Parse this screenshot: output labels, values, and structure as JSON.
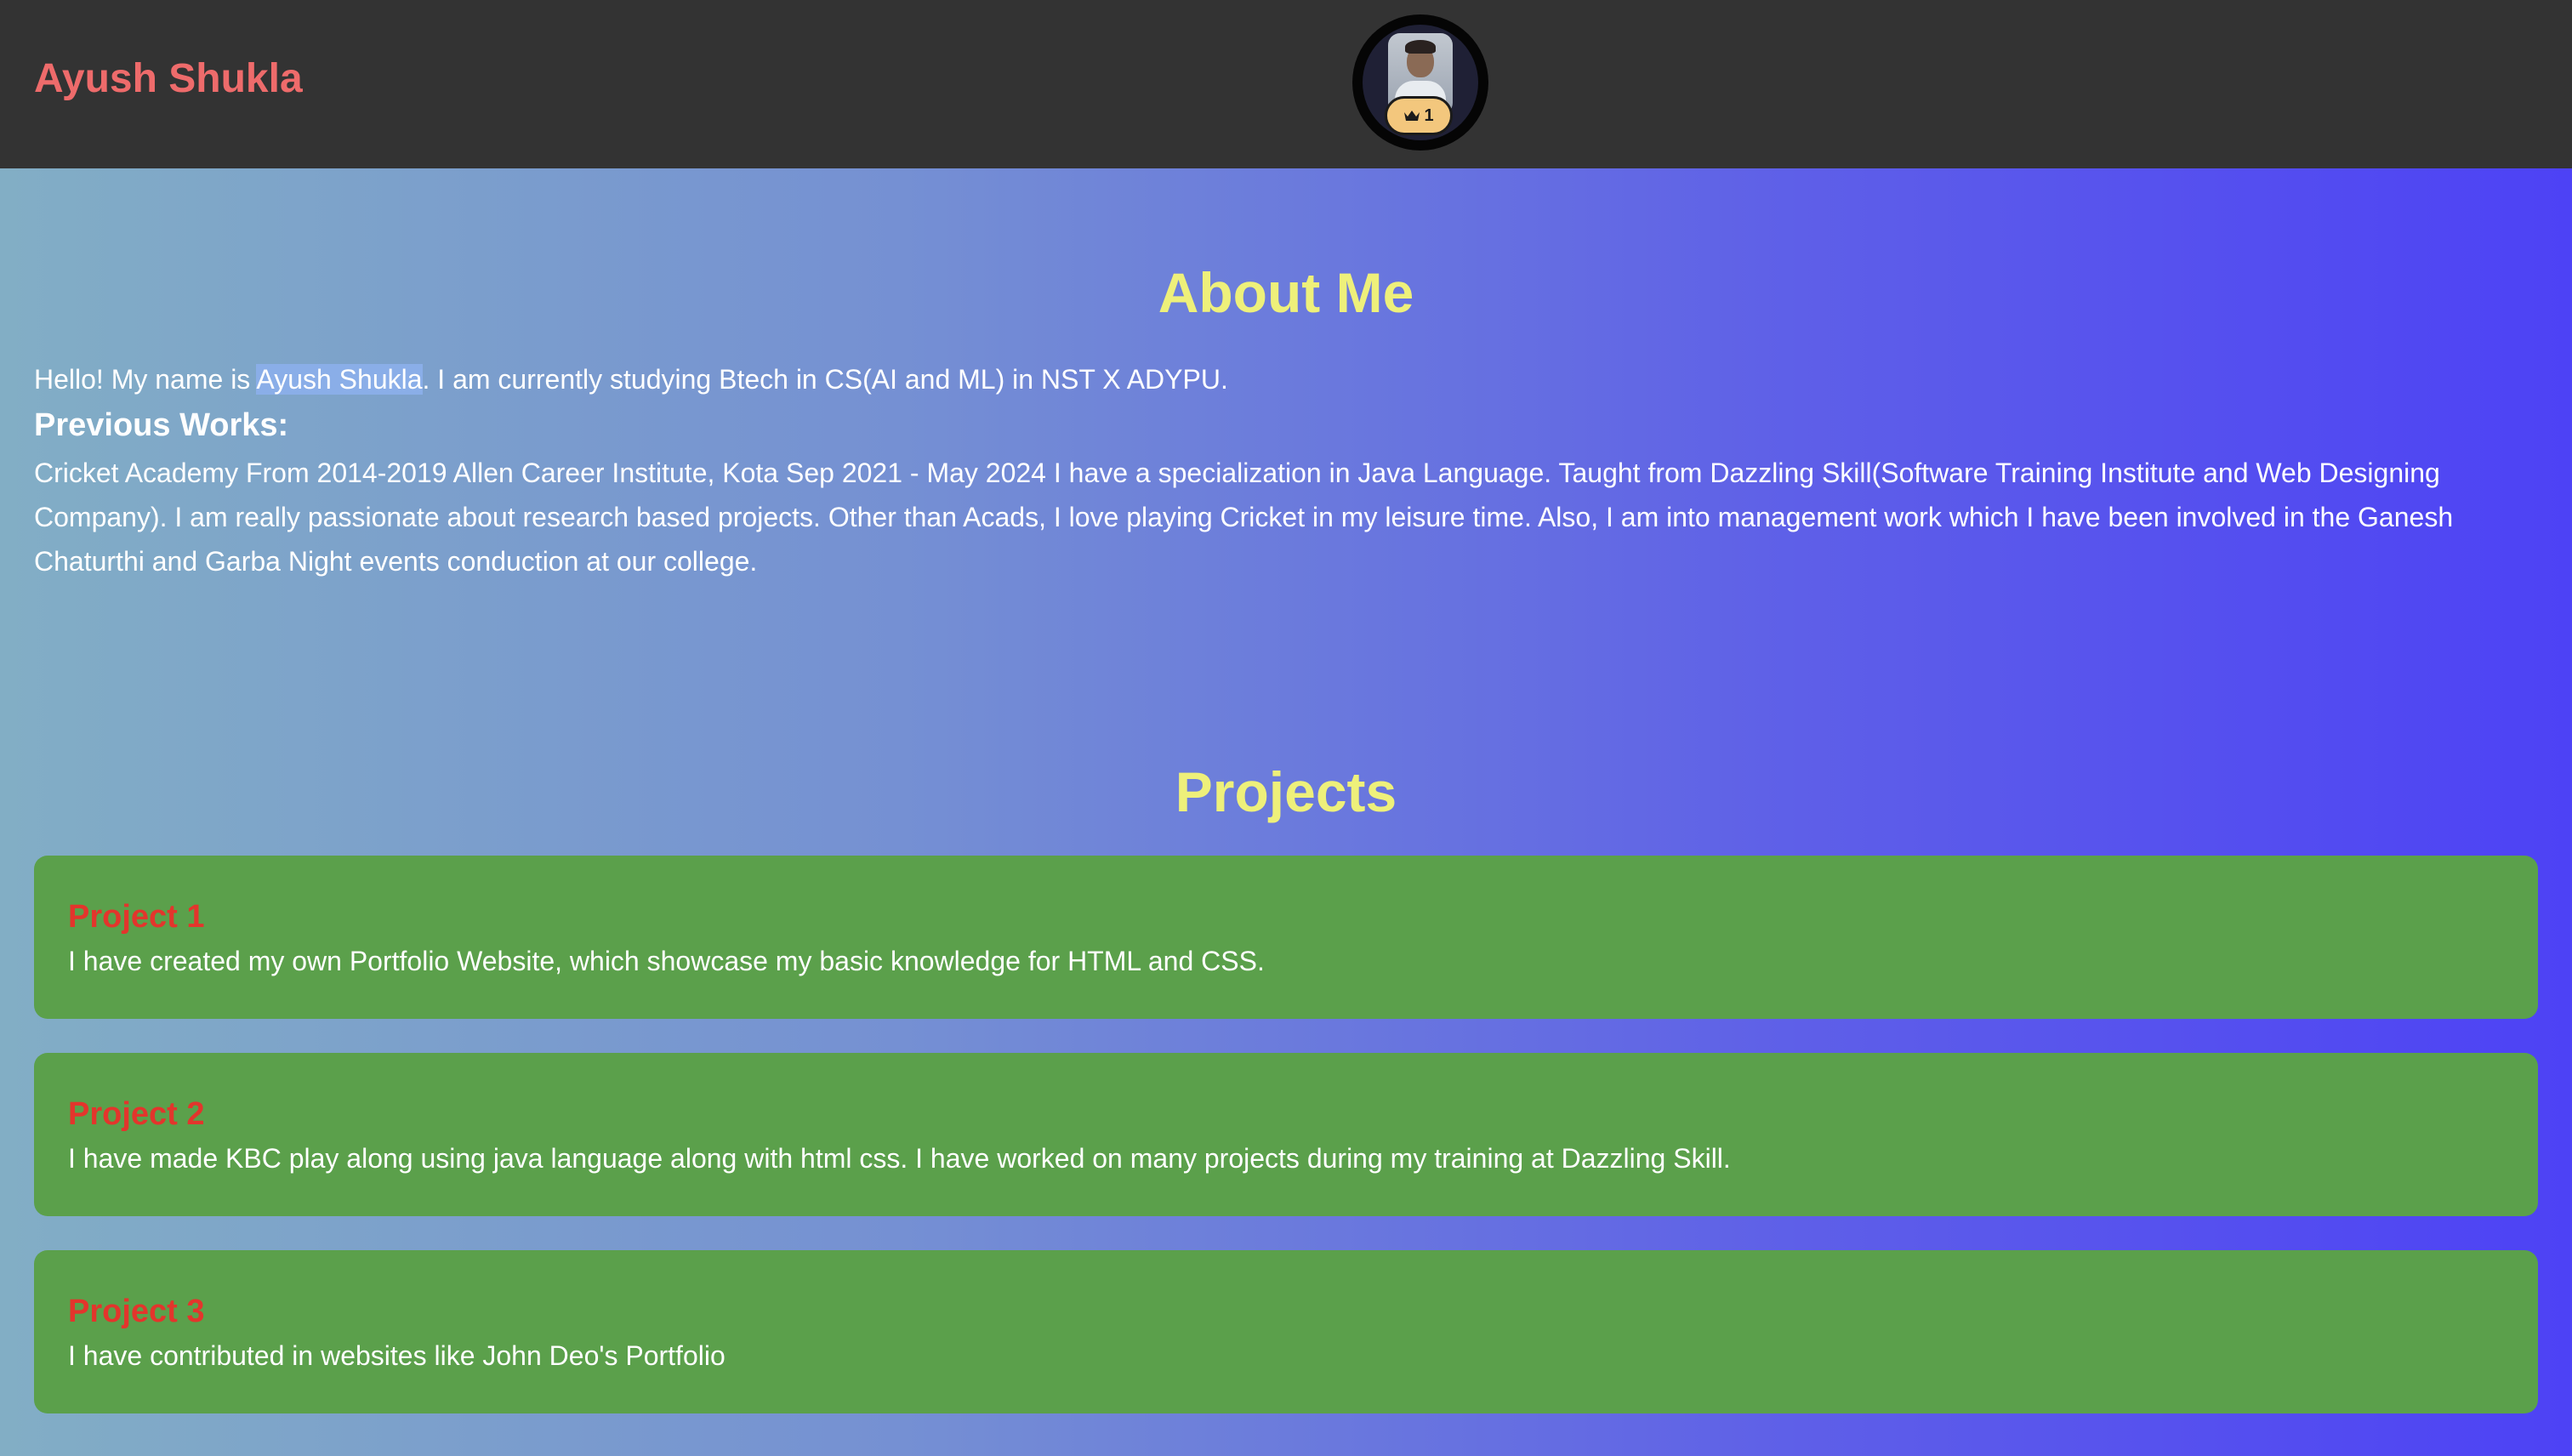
{
  "header": {
    "brand": "Ayush Shukla",
    "badge_count": "1",
    "badge_icon": "crown-icon"
  },
  "about": {
    "title": "About Me",
    "intro_before": "Hello! My name is ",
    "intro_highlight": "Ayush Shukla",
    "intro_after": ". I am currently studying Btech in CS(AI and ML) in NST X ADYPU.",
    "previous_heading": "Previous Works:",
    "previous_body": "Cricket Academy From 2014-2019 Allen Career Institute, Kota Sep 2021 - May 2024 I have a specialization in Java Language. Taught from Dazzling Skill(Software Training Institute and Web Designing Company). I am really passionate about research based projects. Other than Acads, I love playing Cricket in my leisure time. Also, I am into management work which I have been involved in the Ganesh Chaturthi and Garba Night events conduction at our college."
  },
  "projects": {
    "title": "Projects",
    "items": [
      {
        "title": "Project 1",
        "description": "I have created my own Portfolio Website, which showcase my basic knowledge for HTML and CSS."
      },
      {
        "title": "Project 2",
        "description": "I have made KBC play along using java language along with html css. I have worked on many projects during my training at Dazzling Skill."
      },
      {
        "title": "Project 3",
        "description": "I have contributed in websites like John Deo's Portfolio"
      }
    ]
  },
  "colors": {
    "header_bg": "#333333",
    "brand": "#ee6b6b",
    "section_title": "#eef07a",
    "card_bg": "#5ba04b",
    "project_title": "#e3352c",
    "badge_bg": "#f3c77d"
  }
}
